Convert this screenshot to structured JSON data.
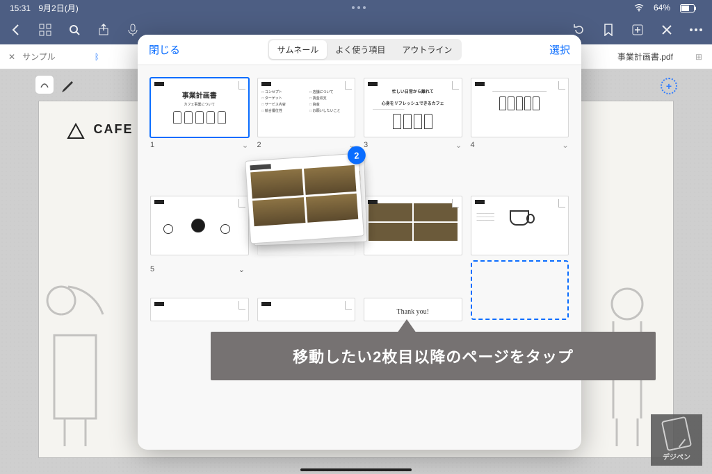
{
  "status": {
    "time": "15:31",
    "date": "9月2日(月)",
    "battery": "64%"
  },
  "tabs": {
    "left": "サンプル",
    "right": "事業計画書.pdf"
  },
  "modal": {
    "close": "閉じる",
    "select": "選択",
    "segments": {
      "thumbnails": "サムネール",
      "favorites": "よく使う項目",
      "outline": "アウトライン"
    },
    "thumb1": {
      "title": "事業計画書",
      "sub": "カフェ事業について"
    },
    "thumb2": {
      "items": [
        "コンセプト",
        "店舗について",
        "ターゲット",
        "賃金収支",
        "サービス内容",
        "資金",
        "競合優位性",
        "お願いしたいこと"
      ]
    },
    "thumb3": {
      "lines": [
        "忙しい日常から離れて",
        "心身をリフレッシュできるカフェ"
      ]
    },
    "drag_badge": "2",
    "page_nums": [
      "1",
      "2",
      "3",
      "4"
    ],
    "page_num_5": "5",
    "thanks": "Thank you!"
  },
  "background_slide": {
    "logo_text": "CAFE"
  },
  "annotation": "移動したい2枚目以降のページをタップ",
  "watermark": "デジペン"
}
